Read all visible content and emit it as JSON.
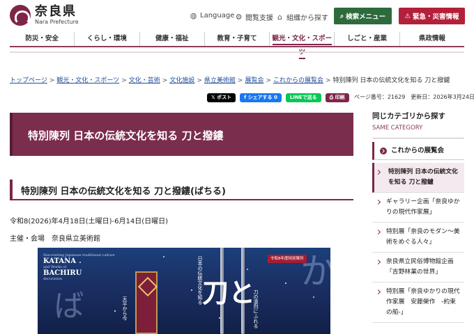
{
  "header": {
    "logo_jp": "奈良県",
    "logo_en": "Nara Prefecture",
    "language": "Language",
    "accessibility": "閲覧支援",
    "org_search": "組織から探す",
    "search_menu": "検索メニュー",
    "emergency": "緊急・災害情報"
  },
  "gnav": [
    "防災・安全",
    "くらし・環境",
    "健康・福祉",
    "教育・子育て",
    "観光・文化・スポーツ",
    "しごと・産業",
    "県政情報"
  ],
  "breadcrumb": [
    "トップページ",
    "観光・文化・スポーツ",
    "文化・芸術",
    "文化施設",
    "県立美術館",
    "展覧会",
    "これからの展覧会"
  ],
  "breadcrumb_current": "特別陳列 日本の伝統文化を知る 刀と撥鑢",
  "share": {
    "x": "ポスト",
    "facebook": "シェアする 0",
    "line": "LINEで送る",
    "print": "印刷"
  },
  "page_info": "ページ番号：21629　更新日：2026年3月24日",
  "main": {
    "title": "特別陳列 日本の伝統文化を知る 刀と撥鏤",
    "subtitle": "特別陳列 日本の伝統文化を知る 刀と撥鏤(ばちる)",
    "period": "令和8(2026)年4月18日(土曜日)-6月14日(日曜日)",
    "venue": "主催・会場　奈良県立美術館"
  },
  "poster": {
    "en_small": "Discovering Japanese traditional culture",
    "en_title_1": "KATANA",
    "en_and": "and Works of",
    "en_title_2": "BACHIRU",
    "en_dec": "decoration",
    "tag": "令和8年度特別陳列",
    "big": "刀と",
    "v1": "日本の伝統文化を知る",
    "v2": "刀の凛烈にふれる",
    "v3": "天平から今"
  },
  "sidebar": {
    "title": "同じカテゴリから探す",
    "sub": "SAME CATEGORY",
    "category": "これからの展覧会",
    "items": [
      "特別陳列 日本の伝統文化を知る 刀と撥鑢",
      "ギャラリー企画「奈良ゆかりの現代作家展」",
      "特別展「奈良のモダン〜美術をめぐる人々」",
      "奈良県立民俗博物館企画「吉野林業の世界」",
      "特別展「奈良ゆかりの現代作家展　安藤榮作　-約束の船-」"
    ]
  },
  "colors": {
    "brand": "#7d2648",
    "search_btn": "#2e6b3c",
    "emergency_btn": "#b3203a",
    "link": "#1f4d9a"
  }
}
